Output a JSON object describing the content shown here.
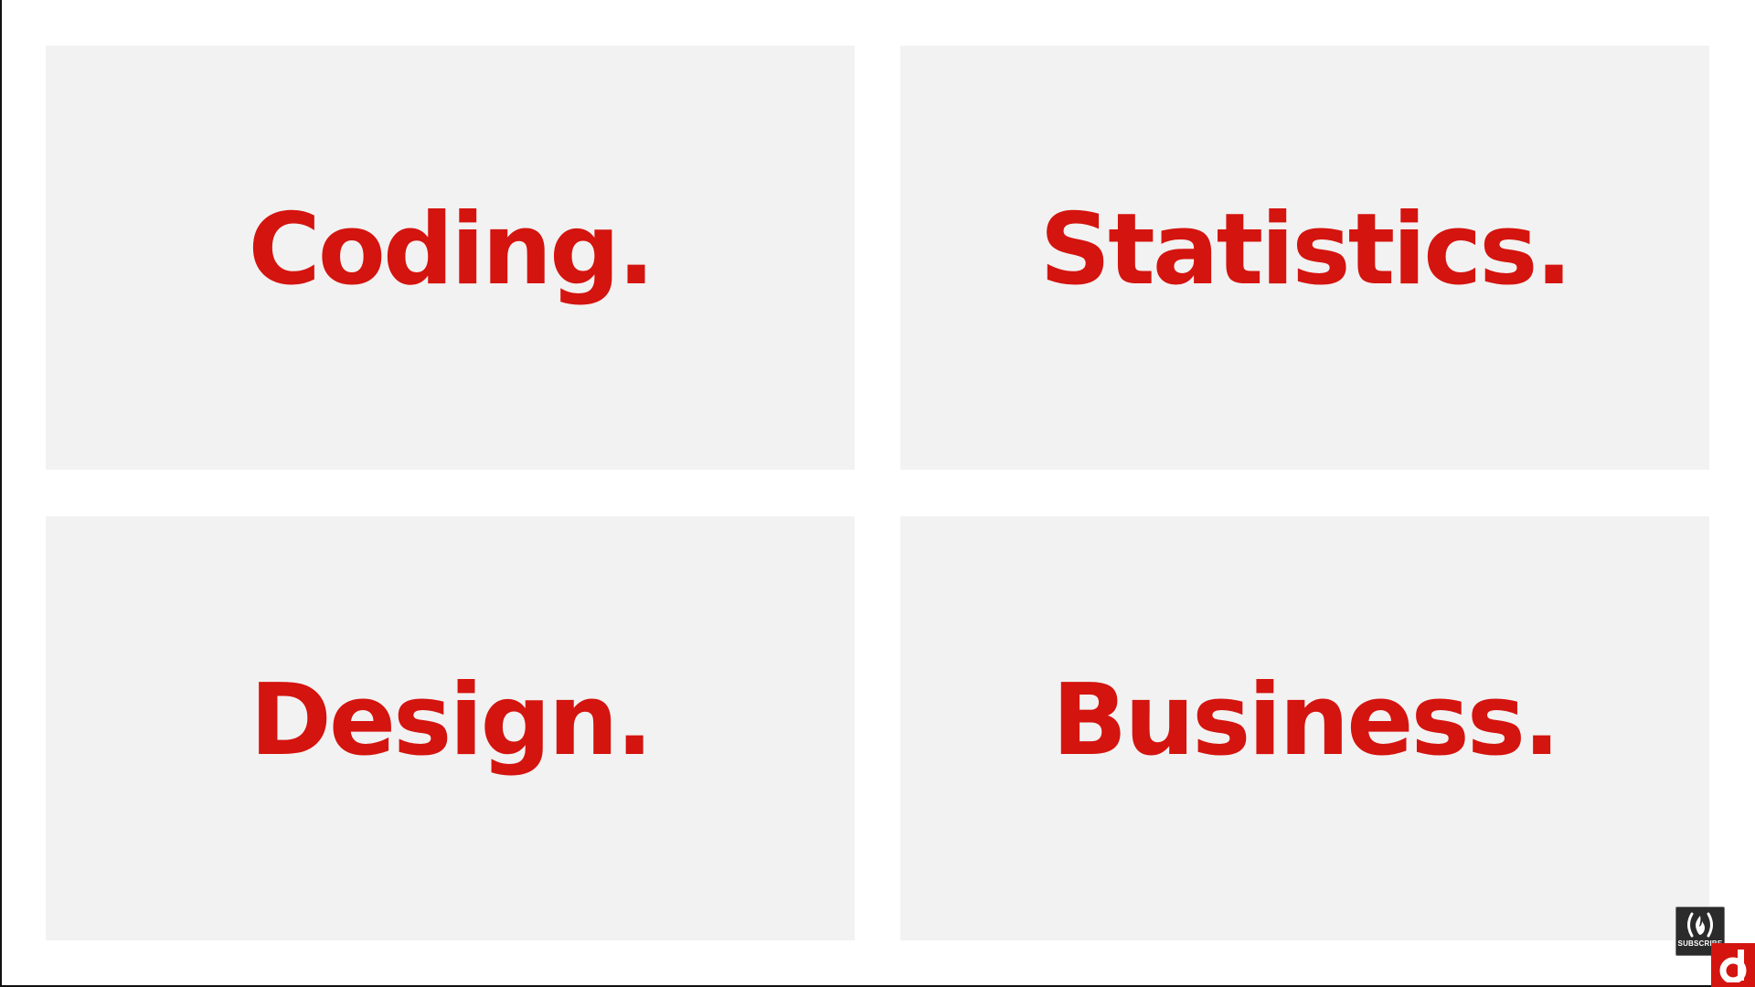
{
  "tiles": [
    {
      "label": "Coding."
    },
    {
      "label": "Statistics."
    },
    {
      "label": "Design."
    },
    {
      "label": "Business."
    }
  ],
  "subscribe_badge": {
    "label": "SUBSCRIBE",
    "icon": "flame-icon"
  },
  "brand_logo": {
    "icon": "letter-d-logo-icon"
  },
  "colors": {
    "accent": "#d4140f",
    "tile_background": "#f2f2f2",
    "page_background": "#ffffff",
    "badge_background": "#2b2b2b"
  }
}
